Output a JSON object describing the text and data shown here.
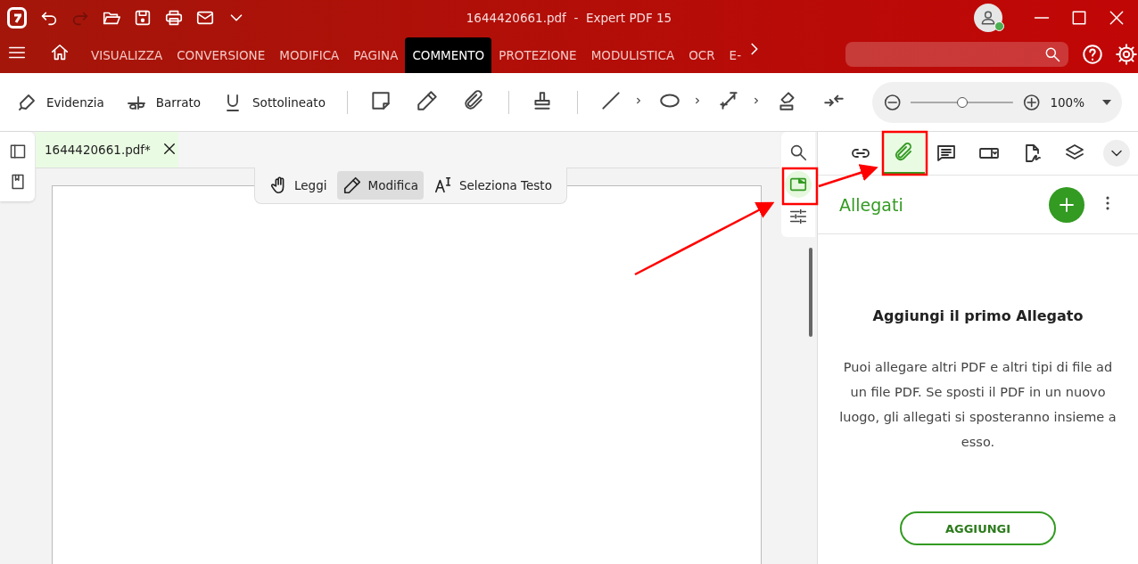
{
  "title_bar": {
    "title": "1644420661.pdf  -  Expert PDF 15",
    "quick_access": [
      {
        "kind": "undo",
        "disabled": false
      },
      {
        "kind": "redo",
        "disabled": true
      },
      {
        "kind": "open",
        "disabled": false
      },
      {
        "kind": "save",
        "disabled": false
      },
      {
        "kind": "print",
        "disabled": false
      },
      {
        "kind": "mail",
        "disabled": false
      },
      {
        "kind": "more",
        "disabled": false
      }
    ]
  },
  "ribbon_tabs": [
    {
      "label": "VISUALIZZA",
      "selected": false
    },
    {
      "label": "CONVERSIONE",
      "selected": false
    },
    {
      "label": "MODIFICA",
      "selected": false
    },
    {
      "label": "PAGINA",
      "selected": false
    },
    {
      "label": "COMMENTO",
      "selected": true
    },
    {
      "label": "PROTEZIONE",
      "selected": false
    },
    {
      "label": "MODULISTICA",
      "selected": false
    },
    {
      "label": "OCR",
      "selected": false
    },
    {
      "label": "E-",
      "selected": false
    }
  ],
  "toolbar": [
    {
      "kind": "highlight",
      "label": "Evidenzia"
    },
    {
      "kind": "strike",
      "label": "Barrato"
    },
    {
      "kind": "underline",
      "label": "Sottolineato"
    },
    {
      "kind": "separator"
    },
    {
      "kind": "note"
    },
    {
      "kind": "pencil"
    },
    {
      "kind": "clip"
    },
    {
      "kind": "separator"
    },
    {
      "kind": "stamp"
    },
    {
      "kind": "separator"
    },
    {
      "kind": "line"
    },
    {
      "kind": "caret"
    },
    {
      "kind": "ellipse"
    },
    {
      "kind": "caret"
    },
    {
      "kind": "measure"
    },
    {
      "kind": "caret"
    },
    {
      "kind": "eraser"
    },
    {
      "kind": "collapse"
    }
  ],
  "zoom": {
    "level": 0.5,
    "reading": "100%"
  },
  "document_tab": {
    "title": "1644420661.pdf*"
  },
  "mode_buttons": [
    {
      "kind": "hand",
      "label": "Leggi",
      "selected": false
    },
    {
      "kind": "pencil",
      "label": "Modifica",
      "selected": true
    },
    {
      "kind": "select",
      "label": "Seleziona Testo",
      "selected": false
    }
  ],
  "side_rail": [
    {
      "kind": "search",
      "selected": false
    },
    {
      "kind": "panel",
      "selected": true
    },
    {
      "kind": "sliders",
      "selected": false
    }
  ],
  "panel_tabs": [
    {
      "kind": "link",
      "selected": false
    },
    {
      "kind": "clip",
      "selected": true
    },
    {
      "kind": "comment",
      "selected": false
    },
    {
      "kind": "field",
      "selected": false
    },
    {
      "kind": "sign",
      "selected": false
    },
    {
      "kind": "layers",
      "selected": false
    }
  ],
  "panel": {
    "title": "Allegati",
    "empty_title": "Aggiungi il primo Allegato",
    "empty_text": "Puoi allegare altri PDF e altri tipi di file ad un file PDF. Se sposti il PDF in un nuovo luogo, gli allegati si sposteranno insieme a esso.",
    "button": "AGGIUNGI"
  }
}
